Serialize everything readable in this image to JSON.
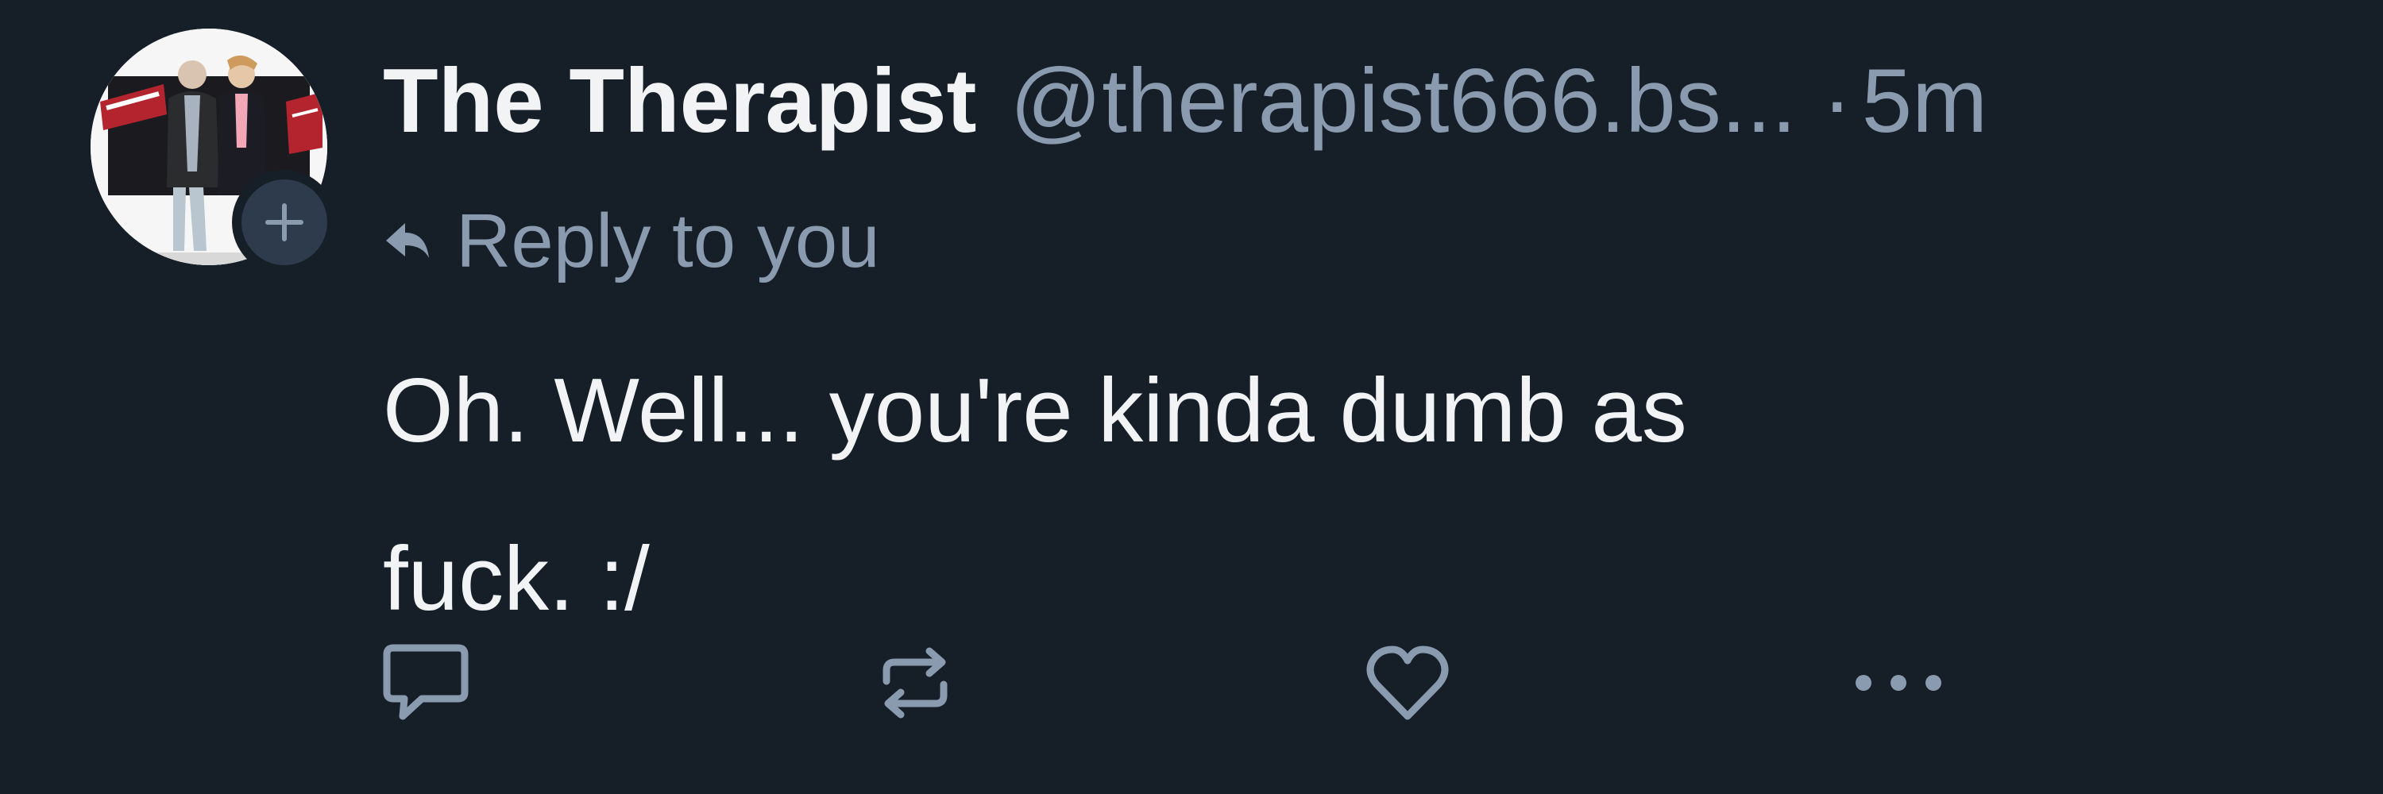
{
  "post": {
    "author": {
      "display_name": "The Therapist",
      "handle": "@therapist666.bs...",
      "avatar_icon": "avatar-photo",
      "follow_icon": "plus-icon"
    },
    "separator": "·",
    "timestamp": "5m",
    "reply_context": {
      "icon": "reply-arrow-icon",
      "text": "Reply to you"
    },
    "text_lines": [
      "Oh. Well... you're kinda dumb as",
      "fuck. :/"
    ],
    "actions": [
      {
        "name": "reply",
        "icon": "comment-icon"
      },
      {
        "name": "repost",
        "icon": "repost-icon"
      },
      {
        "name": "like",
        "icon": "heart-icon"
      },
      {
        "name": "more",
        "icon": "more-dots-icon"
      }
    ]
  },
  "colors": {
    "background": "#161e27",
    "primary_text": "#f1f3f5",
    "secondary_text": "#8a9bb0",
    "icon": "#8a9bb0",
    "follow_badge": "#2e3b4c"
  }
}
